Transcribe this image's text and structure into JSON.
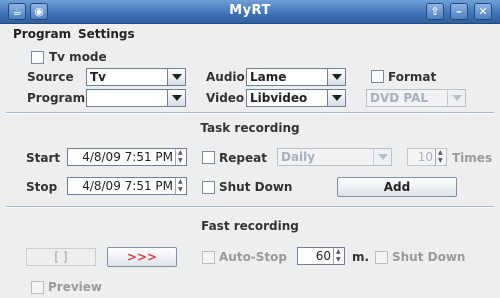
{
  "window": {
    "title": "MyRT"
  },
  "menu": {
    "items": [
      "Program",
      "Settings"
    ]
  },
  "top": {
    "tv_mode_label": "Tv mode",
    "source_label": "Source",
    "source_value": "Tv",
    "program_label": "Program",
    "program_value": "",
    "audio_label": "Audio",
    "audio_value": "Lame",
    "video_label": "Video",
    "video_value": "Libvideo",
    "format_label": "Format",
    "format_value": "DVD PAL"
  },
  "task": {
    "title": "Task recording",
    "start_label": "Start",
    "start_value": "4/8/09 7:51 PM",
    "stop_label": "Stop",
    "stop_value": "4/8/09 7:51 PM",
    "repeat_label": "Repeat",
    "repeat_value": "Daily",
    "times_value": "10",
    "times_label": "Times",
    "shutdown_label": "Shut Down",
    "add_label": "Add"
  },
  "fast": {
    "title": "Fast recording",
    "timer_value": "[ ]",
    "go_label": ">>>",
    "autostop_label": "Auto-Stop",
    "minutes_value": "60",
    "minutes_unit": "m.",
    "shutdown_label": "Shut Down",
    "preview_label": "Preview"
  },
  "colors": {
    "titlebar": "#3f72b8",
    "go_button_text": "#d8403a",
    "separator": "#9db7dc"
  }
}
